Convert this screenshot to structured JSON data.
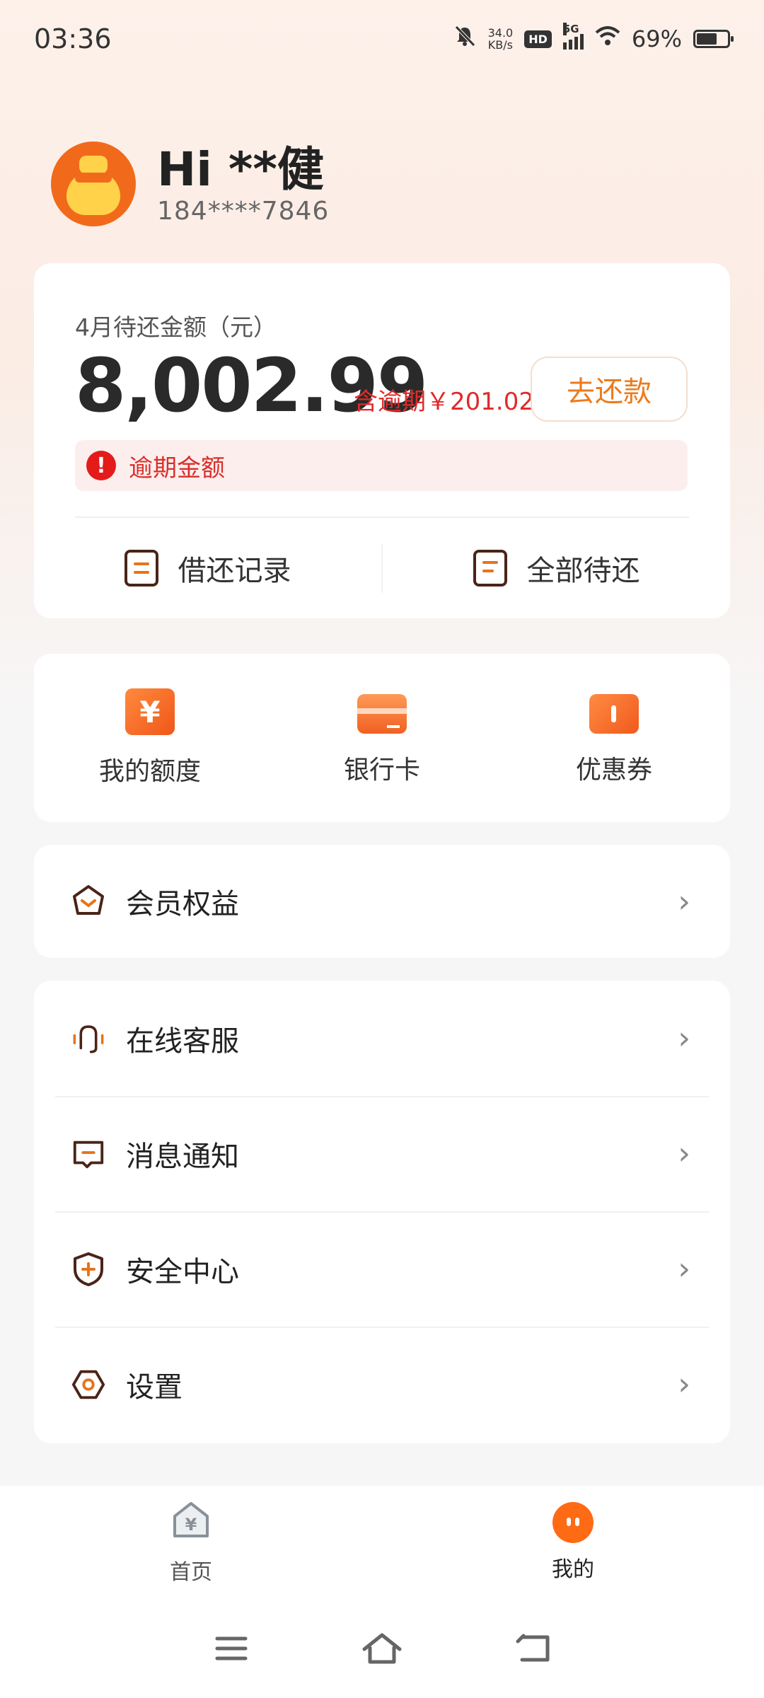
{
  "status_bar": {
    "time": "03:36",
    "net_speed_value": "34.0",
    "net_speed_unit": "KB/s",
    "hd": "HD",
    "network": "5G",
    "battery": "69%"
  },
  "profile": {
    "greeting": "Hi **健",
    "phone": "184****7846"
  },
  "bill": {
    "label": "4月待还金额（元）",
    "amount": "8,002.99",
    "overdue_note": "含逾期￥201.02",
    "repay_button": "去还款",
    "overdue_banner": "逾期金额",
    "actions": [
      "借还记录",
      "全部待还"
    ]
  },
  "quick_links": [
    {
      "label": "我的额度",
      "icon": "yen-quota-icon"
    },
    {
      "label": "银行卡",
      "icon": "bank-card-icon"
    },
    {
      "label": "优惠券",
      "icon": "coupon-icon"
    }
  ],
  "menu_primary": [
    {
      "label": "会员权益",
      "icon": "member-badge-icon"
    }
  ],
  "menu_secondary": [
    {
      "label": "在线客服",
      "icon": "headset-icon"
    },
    {
      "label": "消息通知",
      "icon": "message-icon"
    },
    {
      "label": "安全中心",
      "icon": "shield-icon"
    },
    {
      "label": "设置",
      "icon": "settings-icon"
    }
  ],
  "tabbar": {
    "home": "首页",
    "me": "我的"
  },
  "colors": {
    "accent": "#ee7a1a",
    "danger": "#e02a2a",
    "brand_orange": "#ff6a14"
  }
}
